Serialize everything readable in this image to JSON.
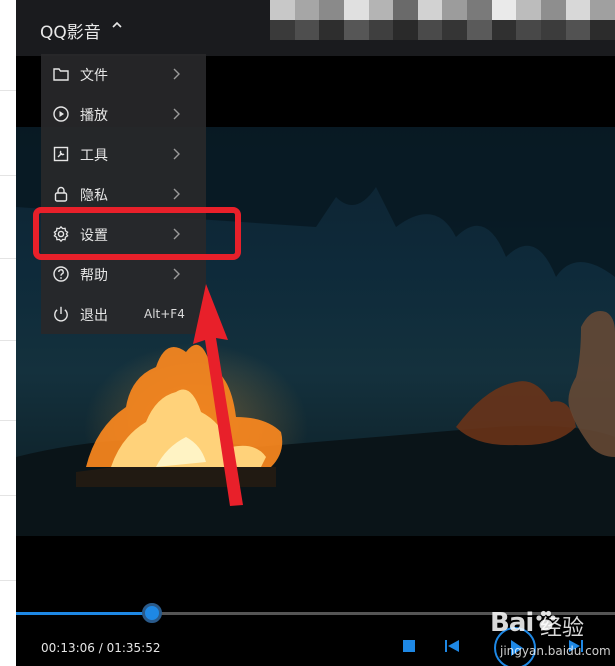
{
  "app": {
    "title": "QQ影音"
  },
  "menu": {
    "items": [
      {
        "label": "文件",
        "icon": "folder-icon"
      },
      {
        "label": "播放",
        "icon": "play-circle-icon"
      },
      {
        "label": "工具",
        "icon": "toolbox-icon"
      },
      {
        "label": "隐私",
        "icon": "lock-icon"
      },
      {
        "label": "设置",
        "icon": "gear-icon"
      },
      {
        "label": "帮助",
        "icon": "help-icon"
      },
      {
        "label": "退出",
        "icon": "power-icon",
        "shortcut": "Alt+F4"
      }
    ]
  },
  "playback": {
    "time_text": "00:13:06 / 01:35:52",
    "progress_fraction": 0.227
  },
  "watermark": {
    "brand": "Bai",
    "brand_suffix": "经验",
    "url": "jingyan.baidu.com"
  },
  "colors": {
    "accent": "#1e88e5",
    "highlight": "#e8202a",
    "menu_bg": "#28282a",
    "titlebar_bg": "#1a1b1e"
  }
}
